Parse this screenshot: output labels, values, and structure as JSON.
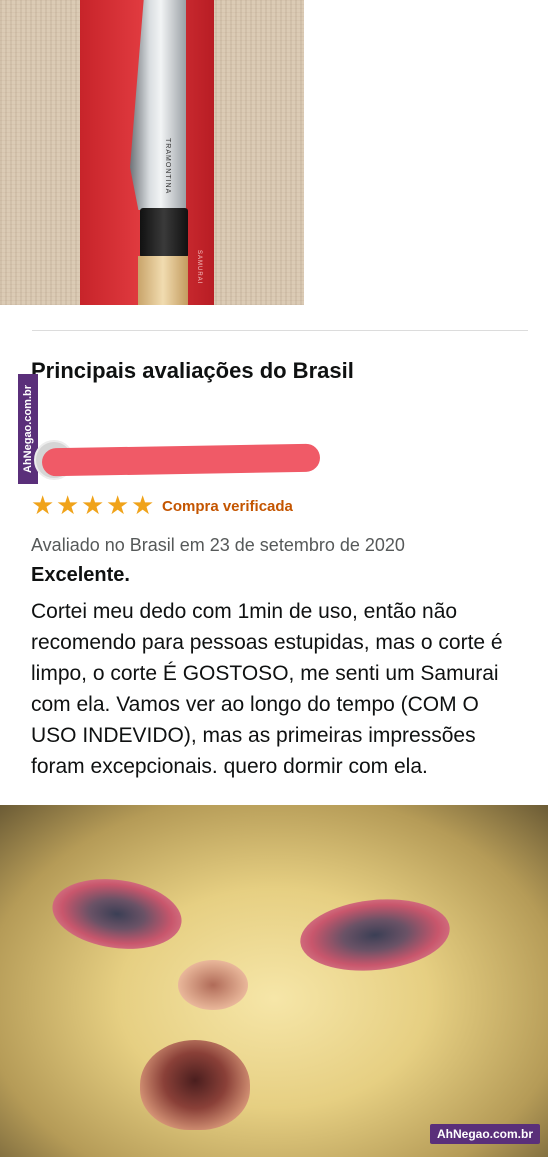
{
  "product": {
    "brand_on_blade": "TRAMONTINA",
    "pack_label": "SAMURAI"
  },
  "reviews": {
    "section_title": "Principais avaliações do Brasil",
    "rating": {
      "value": 5,
      "max": 5,
      "color": "#f0a31a"
    },
    "verified_label": "Compra verificada",
    "date": "Avaliado no Brasil em 23 de setembro de 2020",
    "title": "Excelente.",
    "body": "Cortei meu dedo com 1min de uso, então não recomendo para pessoas estupidas, mas o corte é limpo, o corte É GOSTOSO, me senti um Samurai com ela. Vamos ver ao longo do tempo (COM O USO INDEVIDO), mas as primeiras impressões foram excepcionais. quero dormir com ela."
  },
  "watermarks": {
    "side": "AhNegao.com.br",
    "bottom": "AhNegao.com.br",
    "color": "#5a2f7a"
  },
  "colors": {
    "verified": "#c45500",
    "redaction": "#f05a67"
  }
}
